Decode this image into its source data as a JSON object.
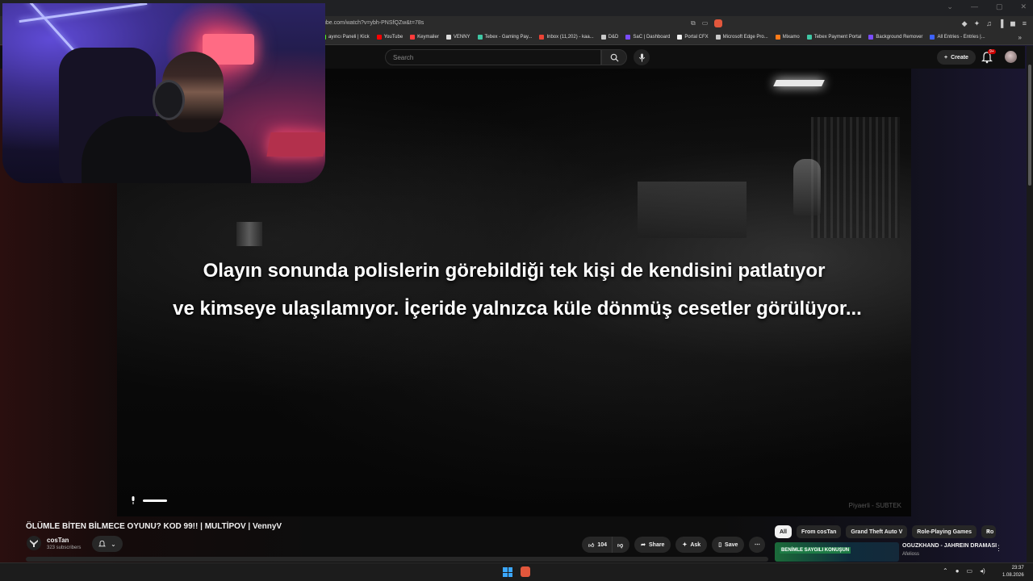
{
  "browser": {
    "url": "tube.com/watch?v=ybh-PNSfQZw&t=78s",
    "bookmarks": [
      {
        "label": "ayıncı Paneli | Kick",
        "color": "#53fc18"
      },
      {
        "label": "YouTube",
        "color": "#ff0000"
      },
      {
        "label": "Keymailer",
        "color": "#ff3b3b"
      },
      {
        "label": "VENNY",
        "color": "#dddddd"
      },
      {
        "label": "Tebex - Gaming Pay...",
        "color": "#3fc7a4"
      },
      {
        "label": "Inbox (11,202) - kaa...",
        "color": "#ea4335"
      },
      {
        "label": "D&D",
        "color": "#c9c9c9"
      },
      {
        "label": "SaC | Dashboard",
        "color": "#7a4cff"
      },
      {
        "label": "Portal CFX",
        "color": "#f2f2f2"
      },
      {
        "label": "Microsoft Edge Pro...",
        "color": "#c9c9c9"
      },
      {
        "label": "Mixamo",
        "color": "#ff7a18"
      },
      {
        "label": "Tebex Payment Portal",
        "color": "#3fc7a4"
      },
      {
        "label": "Background Remover",
        "color": "#7a4cff"
      },
      {
        "label": "All Entries - Entries |...",
        "color": "#3d62ff"
      }
    ]
  },
  "header": {
    "search_placeholder": "Search",
    "create_label": "Create",
    "notif_badge": "9+"
  },
  "video": {
    "subtitle_line1": "Olayın sonunda polislerin görebildiği tek kişi de kendisini patlatıyor",
    "subtitle_line2": "ve kimseye ulaşılamıyor. İçeride yalnızca küle dönmüş cesetler görülüyor...",
    "watermark": "Piyaerli - SUBTEK",
    "title": "ÖLÜMLE BİTEN BİLMECE OYUNU? KOD 99!! | MULTİPOV | VennyV"
  },
  "channel": {
    "name": "cosTan",
    "subscribers": "323 subscribers"
  },
  "actions": {
    "likes": "104",
    "share": "Share",
    "ask": "Ask",
    "save": "Save"
  },
  "chips": [
    "All",
    "From cosTan",
    "Grand Theft Auto V",
    "Role-Playing Games",
    "Ro"
  ],
  "recommendation": {
    "thumb_text": "BENİMLE SAYGILI KONUŞUN",
    "title": "OGUZKHAND - JAHREIN DRAMASI",
    "channel": "Afelioss"
  },
  "taskbar": {
    "time": "23:37",
    "date": "1.08.2026"
  },
  "colors": {
    "accent": "#cc0000",
    "chip_active": "#f1f1f1"
  }
}
